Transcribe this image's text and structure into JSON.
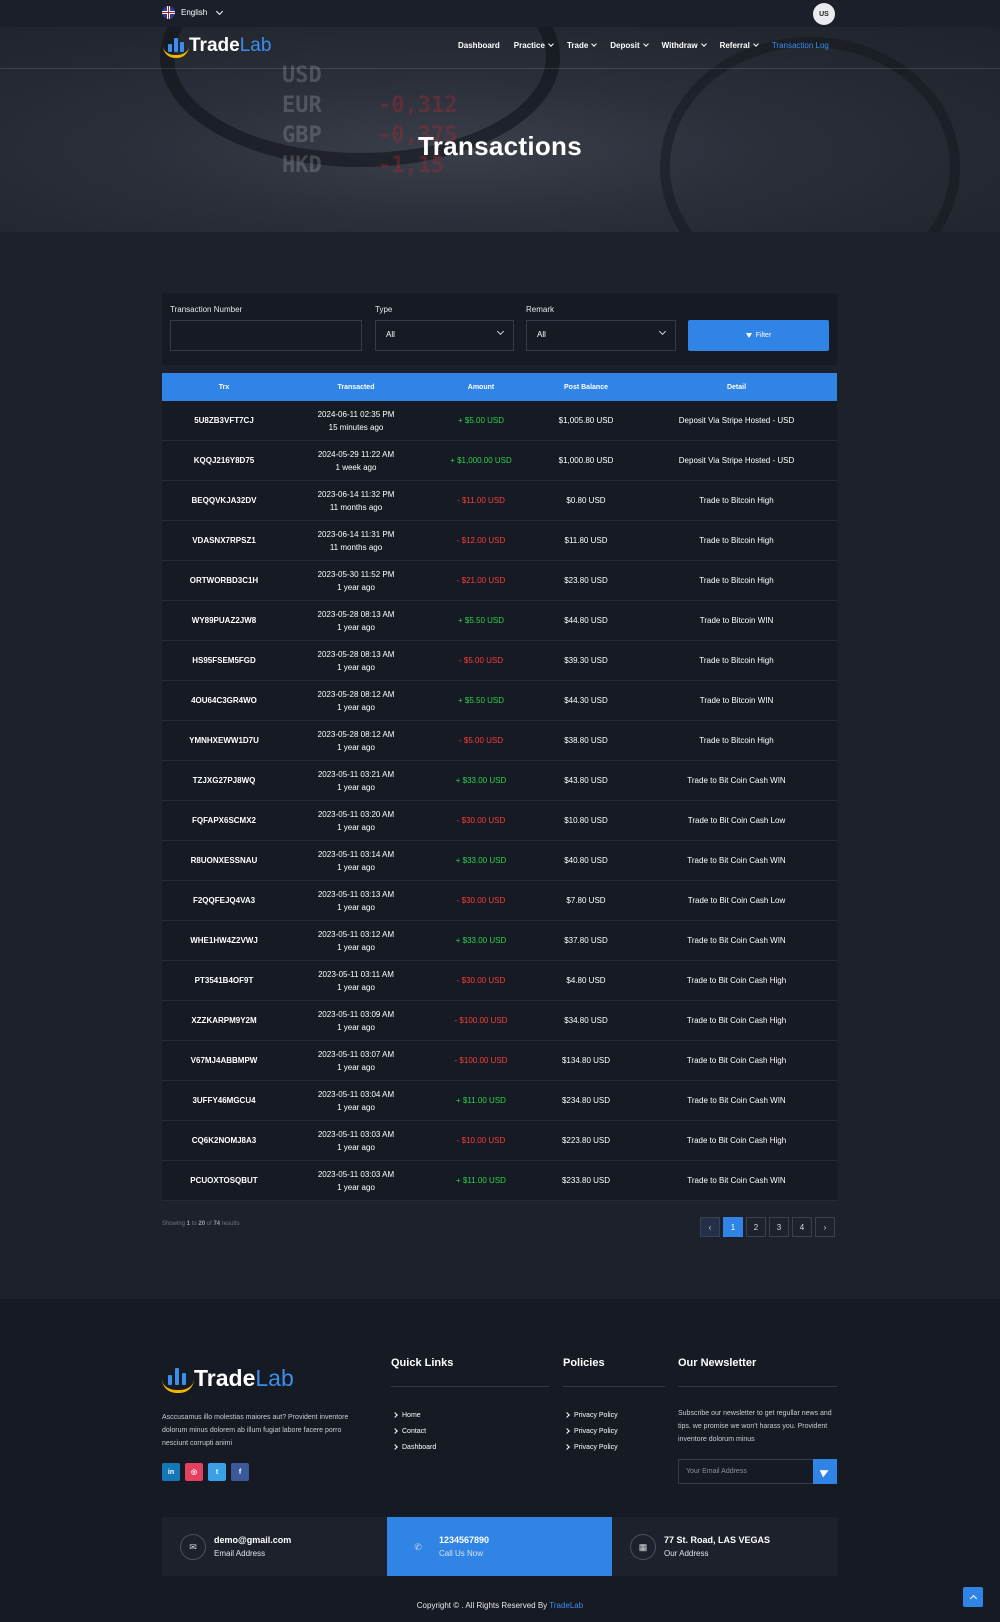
{
  "topbar": {
    "language": "English",
    "avatar_initials": "US"
  },
  "brand": {
    "name_part1": "Trade",
    "name_part2": "Lab"
  },
  "nav": {
    "items": [
      {
        "label": "Dashboard",
        "dropdown": false
      },
      {
        "label": "Practice",
        "dropdown": true
      },
      {
        "label": "Trade",
        "dropdown": true
      },
      {
        "label": "Deposit",
        "dropdown": true
      },
      {
        "label": "Withdraw",
        "dropdown": true
      },
      {
        "label": "Referral",
        "dropdown": true
      },
      {
        "label": "Transaction Log",
        "dropdown": false,
        "active": true
      }
    ]
  },
  "hero": {
    "title": "Transactions",
    "bg_ticker": [
      "USD",
      "EUR",
      "GBP",
      "HKD"
    ],
    "bg_values": [
      "-0,312",
      "-0,375",
      "-1,15"
    ]
  },
  "filter": {
    "trx_label": "Transaction Number",
    "trx_value": "",
    "type_label": "Type",
    "type_value": "All",
    "remark_label": "Remark",
    "remark_value": "All",
    "button_label": "Filter"
  },
  "table": {
    "headers": [
      "Trx",
      "Transacted",
      "Amount",
      "Post Balance",
      "Detail"
    ],
    "rows": [
      {
        "trx": "5U8ZB3VFT7CJ",
        "date": "2024-06-11 02:35 PM",
        "ago": "15 minutes ago",
        "amount": "+ $5.00 USD",
        "sign": "plus",
        "balance": "$1,005.80 USD",
        "detail": "Deposit Via Stripe Hosted - USD"
      },
      {
        "trx": "KQQJ216Y8D75",
        "date": "2024-05-29 11:22 AM",
        "ago": "1 week ago",
        "amount": "+ $1,000.00 USD",
        "sign": "plus",
        "balance": "$1,000.80 USD",
        "detail": "Deposit Via Stripe Hosted - USD"
      },
      {
        "trx": "BEQQVKJA32DV",
        "date": "2023-06-14 11:32 PM",
        "ago": "11 months ago",
        "amount": "- $11.00 USD",
        "sign": "minus",
        "balance": "$0.80 USD",
        "detail": "Trade to Bitcoin High"
      },
      {
        "trx": "VDASNX7RPSZ1",
        "date": "2023-06-14 11:31 PM",
        "ago": "11 months ago",
        "amount": "- $12.00 USD",
        "sign": "minus",
        "balance": "$11.80 USD",
        "detail": "Trade to Bitcoin High"
      },
      {
        "trx": "ORTWORBD3C1H",
        "date": "2023-05-30 11:52 PM",
        "ago": "1 year ago",
        "amount": "- $21.00 USD",
        "sign": "minus",
        "balance": "$23.80 USD",
        "detail": "Trade to Bitcoin High"
      },
      {
        "trx": "WY89PUAZ2JW8",
        "date": "2023-05-28 08:13 AM",
        "ago": "1 year ago",
        "amount": "+ $5.50 USD",
        "sign": "plus",
        "balance": "$44.80 USD",
        "detail": "Trade to Bitcoin WIN"
      },
      {
        "trx": "HS95FSEM5FGD",
        "date": "2023-05-28 08:13 AM",
        "ago": "1 year ago",
        "amount": "- $5.00 USD",
        "sign": "minus",
        "balance": "$39.30 USD",
        "detail": "Trade to Bitcoin High"
      },
      {
        "trx": "4OU64C3GR4WO",
        "date": "2023-05-28 08:12 AM",
        "ago": "1 year ago",
        "amount": "+ $5.50 USD",
        "sign": "plus",
        "balance": "$44.30 USD",
        "detail": "Trade to Bitcoin WIN"
      },
      {
        "trx": "YMNHXEWW1D7U",
        "date": "2023-05-28 08:12 AM",
        "ago": "1 year ago",
        "amount": "- $5.00 USD",
        "sign": "minus",
        "balance": "$38.80 USD",
        "detail": "Trade to Bitcoin High"
      },
      {
        "trx": "TZJXG27PJ8WQ",
        "date": "2023-05-11 03:21 AM",
        "ago": "1 year ago",
        "amount": "+ $33.00 USD",
        "sign": "plus",
        "balance": "$43.80 USD",
        "detail": "Trade to Bit Coin Cash WIN"
      },
      {
        "trx": "FQFAPX6SCMX2",
        "date": "2023-05-11 03:20 AM",
        "ago": "1 year ago",
        "amount": "- $30.00 USD",
        "sign": "minus",
        "balance": "$10.80 USD",
        "detail": "Trade to Bit Coin Cash Low"
      },
      {
        "trx": "R8UONXESSNAU",
        "date": "2023-05-11 03:14 AM",
        "ago": "1 year ago",
        "amount": "+ $33.00 USD",
        "sign": "plus",
        "balance": "$40.80 USD",
        "detail": "Trade to Bit Coin Cash WIN"
      },
      {
        "trx": "F2QQFEJQ4VA3",
        "date": "2023-05-11 03:13 AM",
        "ago": "1 year ago",
        "amount": "- $30.00 USD",
        "sign": "minus",
        "balance": "$7.80 USD",
        "detail": "Trade to Bit Coin Cash Low"
      },
      {
        "trx": "WHE1HW4Z2VWJ",
        "date": "2023-05-11 03:12 AM",
        "ago": "1 year ago",
        "amount": "+ $33.00 USD",
        "sign": "plus",
        "balance": "$37.80 USD",
        "detail": "Trade to Bit Coin Cash WIN"
      },
      {
        "trx": "PT3541B4OF9T",
        "date": "2023-05-11 03:11 AM",
        "ago": "1 year ago",
        "amount": "- $30.00 USD",
        "sign": "minus",
        "balance": "$4.80 USD",
        "detail": "Trade to Bit Coin Cash High"
      },
      {
        "trx": "XZZKARPM9Y2M",
        "date": "2023-05-11 03:09 AM",
        "ago": "1 year ago",
        "amount": "- $100.00 USD",
        "sign": "minus",
        "balance": "$34.80 USD",
        "detail": "Trade to Bit Coin Cash High"
      },
      {
        "trx": "V67MJ4ABBMPW",
        "date": "2023-05-11 03:07 AM",
        "ago": "1 year ago",
        "amount": "- $100.00 USD",
        "sign": "minus",
        "balance": "$134.80 USD",
        "detail": "Trade to Bit Coin Cash High"
      },
      {
        "trx": "3UFFY46MGCU4",
        "date": "2023-05-11 03:04 AM",
        "ago": "1 year ago",
        "amount": "+ $11.00 USD",
        "sign": "plus",
        "balance": "$234.80 USD",
        "detail": "Trade to Bit Coin Cash WIN"
      },
      {
        "trx": "CQ6K2NOMJ8A3",
        "date": "2023-05-11 03:03 AM",
        "ago": "1 year ago",
        "amount": "- $10.00 USD",
        "sign": "minus",
        "balance": "$223.80 USD",
        "detail": "Trade to Bit Coin Cash High"
      },
      {
        "trx": "PCUOXTOSQBUT",
        "date": "2023-05-11 03:03 AM",
        "ago": "1 year ago",
        "amount": "+ $11.00 USD",
        "sign": "plus",
        "balance": "$233.80 USD",
        "detail": "Trade to Bit Coin Cash WIN"
      }
    ]
  },
  "pagination": {
    "showing_prefix": "Showing",
    "from": "1",
    "to_word": "to",
    "to": "20",
    "of_word": "of",
    "total": "74",
    "suffix": "results",
    "prev": "‹",
    "next": "›",
    "pages": [
      "1",
      "2",
      "3",
      "4"
    ],
    "current": "1"
  },
  "footer": {
    "about": "Asccusamus illo molestias maiores aut? Provident inventore dolorum minus dolorem ab illum fugiat labore facere porro nesciunt corrupti animi",
    "social": [
      "in",
      "◎",
      "t",
      "f"
    ],
    "quick_links_title": "Quick Links",
    "quick_links": [
      "Home",
      "Contact",
      "Dashboard"
    ],
    "policies_title": "Policies",
    "policies": [
      "Privacy Policy",
      "Privacy Policy",
      "Privacy Policy"
    ],
    "newsletter_title": "Our Newsletter",
    "newsletter_text": "Subscribe our newsletter to get regullar news and tips. we promise we won't harass you. Provident inventore dolorum minus",
    "newsletter_placeholder": "Your Email Address",
    "contacts": [
      {
        "main": "demo@gmail.com",
        "sub": "Email Address",
        "icon": "envelope-icon"
      },
      {
        "main": "1234567890",
        "sub": "Call Us Now",
        "icon": "phone-icon"
      },
      {
        "main": "77 St. Road, LAS VEGAS",
        "sub": "Our Address",
        "icon": "map-icon"
      }
    ],
    "copyright_prefix": "Copyright © . All Rights Reserved By",
    "copyright_brand": "TradeLab"
  },
  "colors": {
    "accent": "#2f84e6",
    "plus": "#2bd24f",
    "minus": "#ff3b3b",
    "background": "#1c212b",
    "card": "#161a22"
  }
}
